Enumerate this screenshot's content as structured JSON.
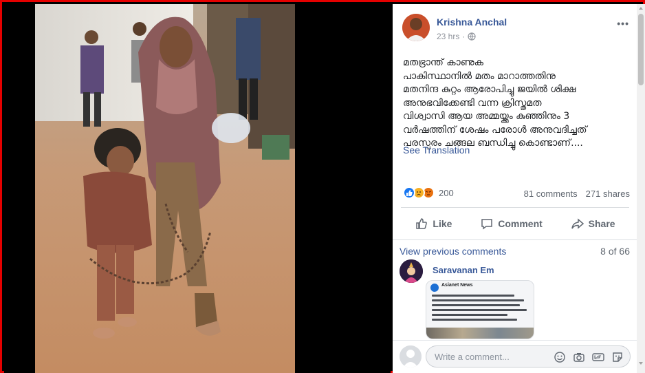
{
  "post": {
    "author": "Krishna Anchal",
    "time": "23 hrs",
    "more": "•••",
    "text_lines": [
      "മതഭ്രാന്ത് കാണുക",
      "പാകിസ്ഥാനിൽ മതം മാറാത്തതിനു",
      "മതനിന്ദ കുറ്റം ആരോപിച്ചു ജയിൽ ശിക്ഷ",
      "അനുഭവിക്കേണ്ടി വന്ന ക്രിസ്തുമത",
      "വിശ്വാസി ആയ അമ്മയ്ക്കും കുഞ്ഞിനും 3",
      "വർഷത്തിന് ശേഷം പരോൾ അനുവദിച്ചത്",
      "പരസ്പരം ചങ്ങല ബന്ധിച്ചു കൊണ്ടാണ്...."
    ],
    "see_translation": "See Translation"
  },
  "stats": {
    "reaction_count": "200",
    "comments": "81 comments",
    "shares": "271 shares"
  },
  "actions": {
    "like": "Like",
    "comment": "Comment",
    "share": "Share"
  },
  "comments_section": {
    "view_previous": "View previous comments",
    "page_count": "8 of 66",
    "commenter_name": "Saravanan Em",
    "card_source": "Asianet News",
    "composer_placeholder": "Write a comment..."
  },
  "colors": {
    "link": "#385898",
    "frame_border": "#e50000",
    "like_blue": "#1877f2",
    "sad_yellow": "#f7b125",
    "angry_orange": "#e9710f"
  },
  "icons": [
    "globe-icon",
    "like-icon",
    "comment-icon",
    "share-icon",
    "emoji-icon",
    "camera-icon",
    "gif-icon",
    "sticker-icon"
  ]
}
